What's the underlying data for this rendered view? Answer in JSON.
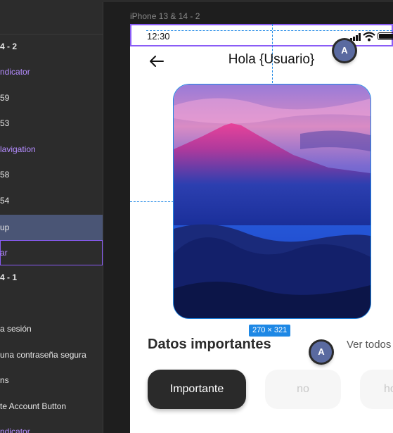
{
  "layers_panel": {
    "items": [
      {
        "label": "4 - 2",
        "style": "bold"
      },
      {
        "label": "ndicator",
        "style": "purple"
      },
      {
        "label": "59",
        "style": "normal"
      },
      {
        "label": "53",
        "style": "normal"
      },
      {
        "label": "lavigation",
        "style": "purple"
      },
      {
        "label": "58",
        "style": "normal"
      },
      {
        "label": "54",
        "style": "normal"
      },
      {
        "label": "up",
        "style": "selected"
      },
      {
        "label": "ar",
        "style": "hovered"
      },
      {
        "label": "4 - 1",
        "style": "bold"
      },
      {
        "label": "",
        "style": "normal"
      },
      {
        "label": "a sesión",
        "style": "normal"
      },
      {
        "label": "una contraseña segura",
        "style": "normal"
      },
      {
        "label": "ns",
        "style": "normal"
      },
      {
        "label": "te Account Button",
        "style": "normal"
      },
      {
        "label": "ndicator",
        "style": "purple"
      }
    ]
  },
  "canvas": {
    "frame_label": "iPhone 13 & 14 - 2",
    "measure_badge": "270 × 321",
    "avatar_letter": "A"
  },
  "phone": {
    "status_time": "12:30",
    "header_title": "Hola {Usuario}",
    "section_title": "Datos importantes",
    "see_all": "Ver todos",
    "chips": [
      "Importante",
      "no",
      "ho"
    ]
  },
  "colors": {
    "accent_purple": "#8a5cf6",
    "guide_blue": "#1e88e5",
    "selected_layer": "#4a5575",
    "chip_active": "#2a2a2a"
  }
}
